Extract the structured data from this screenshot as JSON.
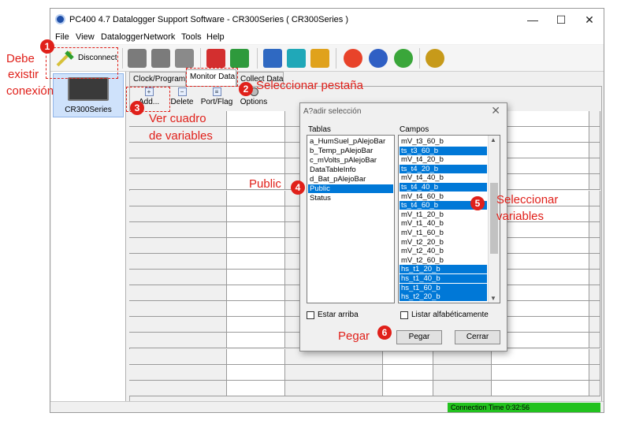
{
  "window": {
    "title": "PC400 4.7 Datalogger Support Software - CR300Series ( CR300Series )",
    "minimize": "—",
    "maximize": "☐",
    "close": "✕"
  },
  "menu": [
    "File",
    "View",
    "Datalogger",
    "Network",
    "Tools",
    "Help"
  ],
  "toolbar": {
    "disconnect_label": "Disconnect"
  },
  "station": {
    "name": "CR300Series"
  },
  "tabs": [
    "Clock/Program",
    "Monitor Data",
    "Collect Data"
  ],
  "subtoolbar": [
    "Add...",
    "Delete",
    "Port/Flag",
    "Options"
  ],
  "dialog": {
    "title": "A?adir selección",
    "tables_header": "Tablas",
    "fields_header": "Campos",
    "tables": [
      {
        "label": "a_HumSuel_pAlejoBar",
        "selected": false
      },
      {
        "label": "b_Temp_pAlejoBar",
        "selected": false
      },
      {
        "label": "c_mVolts_pAlejoBar",
        "selected": false
      },
      {
        "label": "DataTableInfo",
        "selected": false
      },
      {
        "label": "d_Bat_pAlejoBar",
        "selected": false
      },
      {
        "label": "Public",
        "selected": true
      },
      {
        "label": "Status",
        "selected": false
      }
    ],
    "fields": [
      {
        "label": "mV_t3_60_b",
        "selected": false
      },
      {
        "label": "ts_t3_60_b",
        "selected": true
      },
      {
        "label": "mV_t4_20_b",
        "selected": false
      },
      {
        "label": "ts_t4_20_b",
        "selected": true
      },
      {
        "label": "mV_t4_40_b",
        "selected": false
      },
      {
        "label": "ts_t4_40_b",
        "selected": true
      },
      {
        "label": "mV_t4_60_b",
        "selected": false
      },
      {
        "label": "ts_t4_60_b",
        "selected": true
      },
      {
        "label": "mV_t1_20_b",
        "selected": false
      },
      {
        "label": "mV_t1_40_b",
        "selected": false
      },
      {
        "label": "mV_t1_60_b",
        "selected": false
      },
      {
        "label": "mV_t2_20_b",
        "selected": false
      },
      {
        "label": "mV_t2_40_b",
        "selected": false
      },
      {
        "label": "mV_t2_60_b",
        "selected": false
      },
      {
        "label": "hs_t1_20_b",
        "selected": true
      },
      {
        "label": "hs_t1_40_b",
        "selected": true
      },
      {
        "label": "hs_t1_60_b",
        "selected": true
      },
      {
        "label": "hs_t2_20_b",
        "selected": true
      }
    ],
    "stay_on_top": "Estar arriba",
    "alphabetical": "Listar alfabéticamente",
    "paste_button": "Pegar",
    "close_button": "Cerrar",
    "close_icon": "✕"
  },
  "status": {
    "connection_time": "Connection Time 0:32:56",
    "connection_color": "#22c21e"
  },
  "annotations": {
    "step1_label": "Debe existir conexión",
    "step1_line1": "Debe",
    "step1_line2": "existir",
    "step1_line3": "conexión",
    "step2_label": "Seleccionar pestaña",
    "step3_line1": "Ver cuadro",
    "step3_line2": "de variables",
    "step4_label": "Public",
    "step5_line1": "Seleccionar",
    "step5_line2": "variables",
    "step6_label": "Pegar",
    "badges": [
      "1",
      "2",
      "3",
      "4",
      "5",
      "6"
    ],
    "color": "#e0201a"
  }
}
